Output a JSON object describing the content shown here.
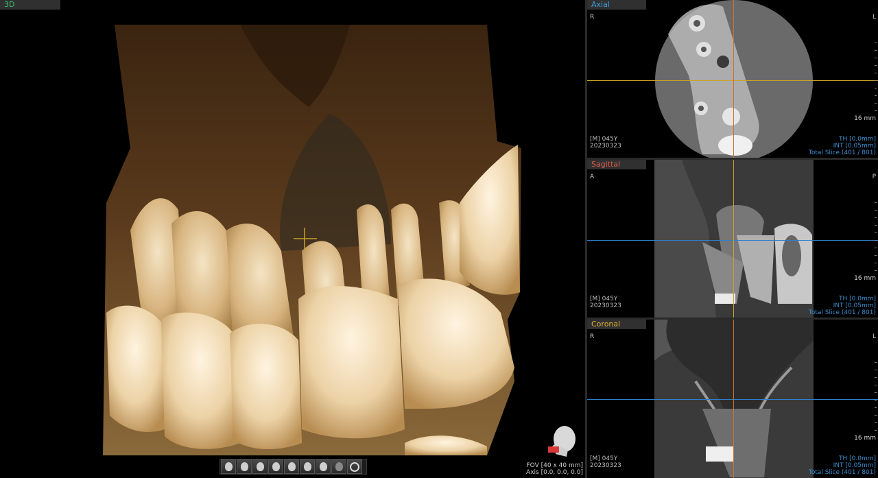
{
  "panes": {
    "3d": {
      "label": "3D"
    },
    "axial": {
      "label": "Axial",
      "left_marker": "R",
      "right_marker": "L",
      "scale": "16 mm",
      "patient": "[M] 045Y",
      "date": "20230323",
      "th": "TH [0.0mm]",
      "int": "INT [0.05mm]",
      "slice": "Total Slice (401 / 801)"
    },
    "sagittal": {
      "label": "Sagittal",
      "left_marker": "A",
      "right_marker": "P",
      "scale": "16 mm",
      "patient": "[M] 045Y",
      "date": "20230323",
      "th": "TH [0.0mm]",
      "int": "INT [0.05mm]",
      "slice": "Total Slice (401 / 801)"
    },
    "coronal": {
      "label": "Coronal",
      "left_marker": "R",
      "right_marker": "L",
      "scale": "16 mm",
      "patient": "[M] 045Y",
      "date": "20230323",
      "th": "TH [0.0mm]",
      "int": "INT [0.05mm]",
      "slice": "Total Slice (401 / 801)"
    }
  },
  "fov": "FOV [40 x 40 mm]",
  "axis": "Axis [0.0, 0.0, 0.0]",
  "colors": {
    "axial_label": "#3b9be0",
    "sagittal_label": "#e05a4a",
    "coronal_label": "#e0b030",
    "label_3d": "#3cbf6a",
    "line_orange": "#c8762a",
    "line_blue": "#2f7fd0",
    "line_yellow": "#c9a227"
  },
  "toolbar_icons": [
    "head-front-icon",
    "head-left-icon",
    "head-right-icon",
    "head-back-icon",
    "head-top-icon",
    "head-bottom-icon",
    "skull-icon",
    "mask-icon",
    "rotate-icon"
  ]
}
